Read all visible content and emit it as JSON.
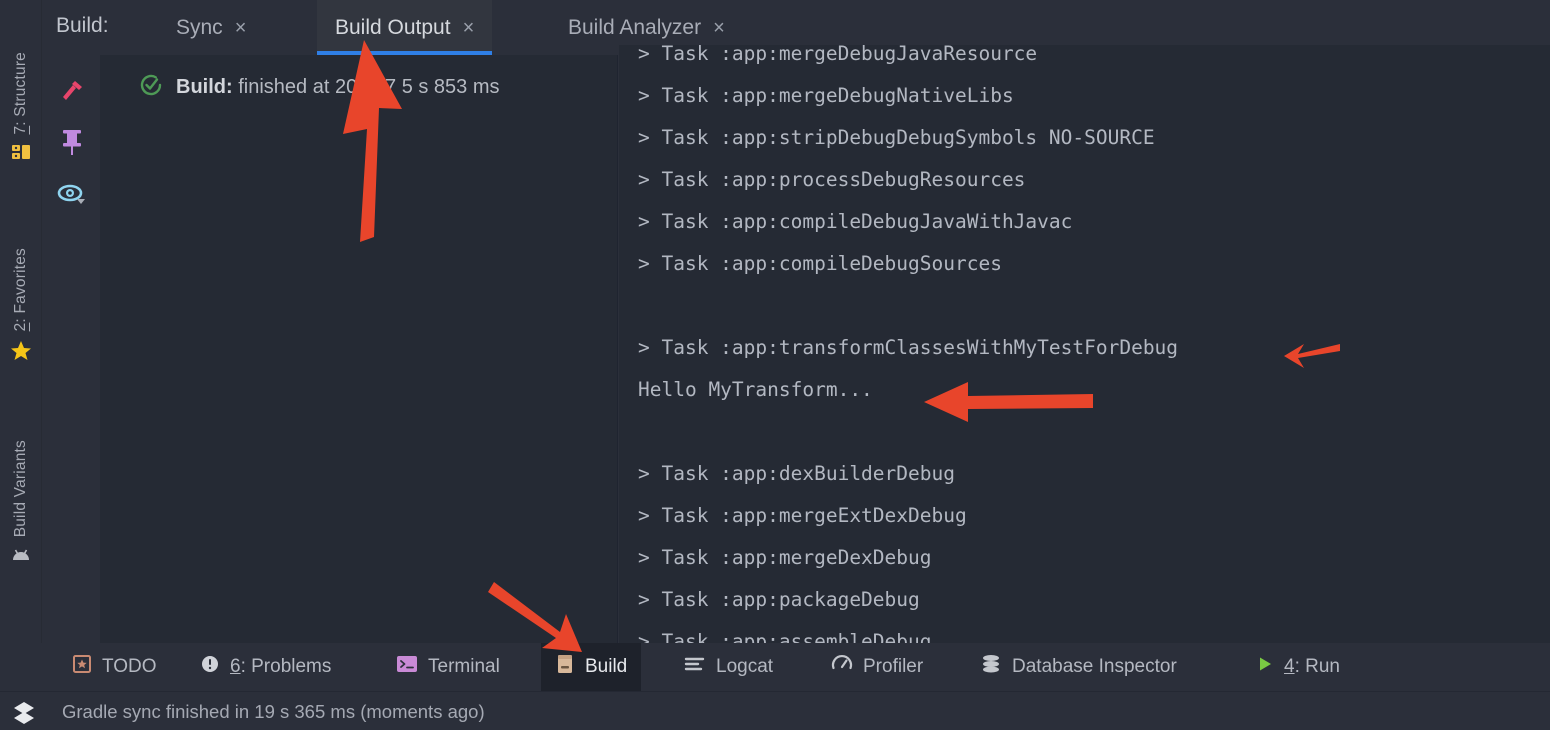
{
  "window": {
    "background_color": "#2b2f3a",
    "panel_color": "#252a34",
    "accent_color": "#2f7fe6",
    "arrow_color": "#e8452b"
  },
  "tabbar": {
    "title": "Build:",
    "tabs": [
      {
        "label": "Sync",
        "close": "×",
        "active": false
      },
      {
        "label": "Build Output",
        "close": "×",
        "active": true
      },
      {
        "label": "Build Analyzer",
        "close": "×",
        "active": false
      }
    ]
  },
  "left_strip": {
    "items": [
      {
        "label_prefix": "7",
        "label_suffix": ": Structure",
        "icon": "structure-icon"
      },
      {
        "label_prefix": "2",
        "label_suffix": ": Favorites",
        "icon": "star-icon"
      },
      {
        "label_prefix": "",
        "label_suffix": "Build Variants",
        "icon": "android-icon"
      }
    ]
  },
  "build_toolbar": {
    "icons": [
      {
        "name": "hammer-icon",
        "color": "#e8456b"
      },
      {
        "name": "pin-icon",
        "color": "#c08ae0"
      },
      {
        "name": "eye-icon",
        "color": "#8fd4ef"
      }
    ]
  },
  "build_tree": {
    "status_icon": "check-circle-icon",
    "status_bold": "Build:",
    "status_text": "finished at 2021/7",
    "status_duration": "5 s 853 ms"
  },
  "log": {
    "lines": [
      "> Task :app:mergeDebugJavaResource",
      "> Task :app:mergeDebugNativeLibs",
      "> Task :app:stripDebugDebugSymbols NO-SOURCE",
      "> Task :app:processDebugResources",
      "> Task :app:compileDebugJavaWithJavac",
      "> Task :app:compileDebugSources",
      "",
      "> Task :app:transformClassesWithMyTestForDebug",
      "Hello MyTransform...",
      "",
      "> Task :app:dexBuilderDebug",
      "> Task :app:mergeExtDexDebug",
      "> Task :app:mergeDexDebug",
      "> Task :app:packageDebug",
      "> Task :app:assembleDebug"
    ]
  },
  "bottom_bar": {
    "buttons": [
      {
        "label": "TODO",
        "icon": "todo-icon",
        "mnemonic": "",
        "active": false
      },
      {
        "label": ": Problems",
        "icon": "problems-icon",
        "mnemonic": "6",
        "active": false
      },
      {
        "label": "Terminal",
        "icon": "terminal-icon",
        "mnemonic": "",
        "active": false
      },
      {
        "label": "Build",
        "icon": "build-icon",
        "mnemonic": "",
        "active": true
      },
      {
        "label": "Logcat",
        "icon": "logcat-icon",
        "mnemonic": "",
        "active": false
      },
      {
        "label": "Profiler",
        "icon": "profiler-icon",
        "mnemonic": "",
        "active": false
      },
      {
        "label": "Database Inspector",
        "icon": "database-icon",
        "mnemonic": "",
        "active": false
      },
      {
        "label": ": Run",
        "icon": "run-icon",
        "mnemonic": "4",
        "active": false
      }
    ]
  },
  "status_bar": {
    "icon": "layers-icon",
    "text": "Gradle sync finished in 19 s 365 ms (moments ago)"
  },
  "annotations": [
    {
      "name": "arrow-to-build-output-tab",
      "direction": "up"
    },
    {
      "name": "arrow-to-transform-task",
      "direction": "left-small"
    },
    {
      "name": "arrow-to-hello-mytransform",
      "direction": "left-large"
    },
    {
      "name": "arrow-to-build-tool-button",
      "direction": "down-right"
    }
  ]
}
